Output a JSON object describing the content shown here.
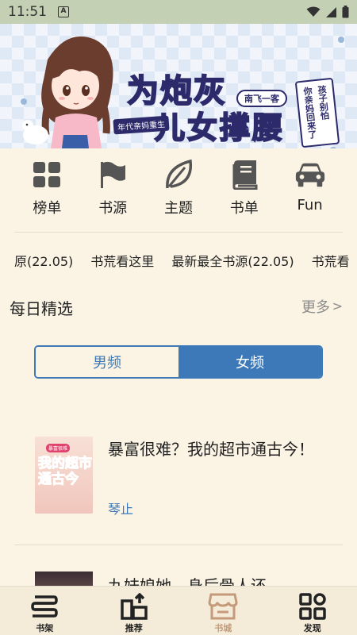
{
  "status_bar": {
    "time": "11:51",
    "badge": "A"
  },
  "banner": {
    "title_line1": "为炮灰",
    "title_line2": "儿女撑腰",
    "author": "南飞一客",
    "subtitle": "年代亲妈重生",
    "scroll_text_1": "孩子别怕",
    "scroll_text_2": "你亲妈回来了"
  },
  "categories": [
    {
      "label": "榜单",
      "icon": "grid-icon"
    },
    {
      "label": "书源",
      "icon": "flag-icon"
    },
    {
      "label": "主题",
      "icon": "leaf-icon"
    },
    {
      "label": "书单",
      "icon": "book-icon"
    },
    {
      "label": "Fun",
      "icon": "car-icon"
    }
  ],
  "ticker": [
    "原(22.05)",
    "书荒看这里",
    "最新最全书源(22.05)",
    "书荒看"
  ],
  "daily": {
    "title": "每日精选",
    "more": "更多",
    "more_arrow": ">"
  },
  "segment": {
    "male": "男频",
    "female": "女频",
    "selected": "女频"
  },
  "books": [
    {
      "title": "暴富很难？我的超市通古今！",
      "author": "琴止",
      "cover_text": "我的超市通古今",
      "cover_tag": "暴富很难"
    },
    {
      "title": "九妹娘她，身后骨人还"
    }
  ],
  "bottom_nav": [
    {
      "label": "书架",
      "icon": "bookshelf-icon"
    },
    {
      "label": "推荐",
      "icon": "recommend-icon"
    },
    {
      "label": "书城",
      "icon": "store-icon"
    },
    {
      "label": "发现",
      "icon": "discover-icon"
    }
  ],
  "colors": {
    "accent": "#3d79b9",
    "background": "#fbf4e4",
    "status_bar": "#c3d0b4",
    "active_nav": "#c49a7a"
  }
}
